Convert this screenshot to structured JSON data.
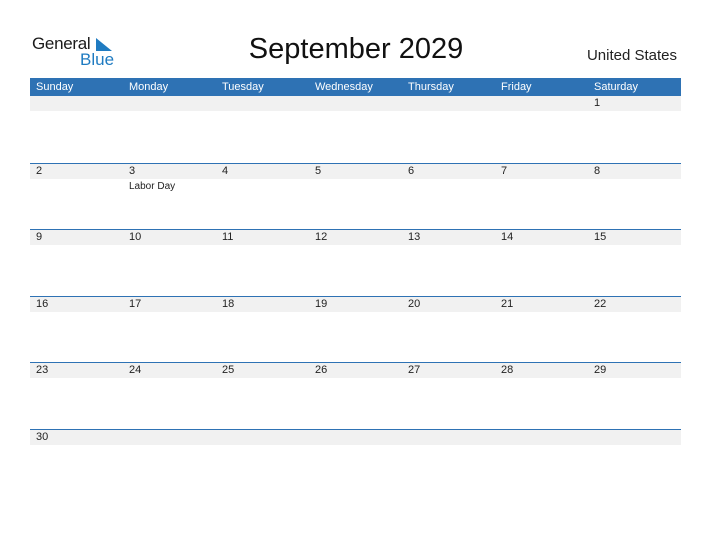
{
  "logo": {
    "line1": "General",
    "line2": "Blue"
  },
  "title": "September 2029",
  "country": "United States",
  "weekdays": [
    "Sunday",
    "Monday",
    "Tuesday",
    "Wednesday",
    "Thursday",
    "Friday",
    "Saturday"
  ],
  "weeks": [
    [
      {
        "d": ""
      },
      {
        "d": ""
      },
      {
        "d": ""
      },
      {
        "d": ""
      },
      {
        "d": ""
      },
      {
        "d": ""
      },
      {
        "d": "1"
      }
    ],
    [
      {
        "d": "2"
      },
      {
        "d": "3",
        "e": "Labor Day"
      },
      {
        "d": "4"
      },
      {
        "d": "5"
      },
      {
        "d": "6"
      },
      {
        "d": "7"
      },
      {
        "d": "8"
      }
    ],
    [
      {
        "d": "9"
      },
      {
        "d": "10"
      },
      {
        "d": "11"
      },
      {
        "d": "12"
      },
      {
        "d": "13"
      },
      {
        "d": "14"
      },
      {
        "d": "15"
      }
    ],
    [
      {
        "d": "16"
      },
      {
        "d": "17"
      },
      {
        "d": "18"
      },
      {
        "d": "19"
      },
      {
        "d": "20"
      },
      {
        "d": "21"
      },
      {
        "d": "22"
      }
    ],
    [
      {
        "d": "23"
      },
      {
        "d": "24"
      },
      {
        "d": "25"
      },
      {
        "d": "26"
      },
      {
        "d": "27"
      },
      {
        "d": "28"
      },
      {
        "d": "29"
      }
    ],
    [
      {
        "d": "30"
      },
      {
        "d": ""
      },
      {
        "d": ""
      },
      {
        "d": ""
      },
      {
        "d": ""
      },
      {
        "d": ""
      },
      {
        "d": ""
      }
    ]
  ],
  "colors": {
    "accent": "#2e72b4",
    "logo_blue": "#1f7bc1",
    "day_bg": "#f1f1f1"
  }
}
